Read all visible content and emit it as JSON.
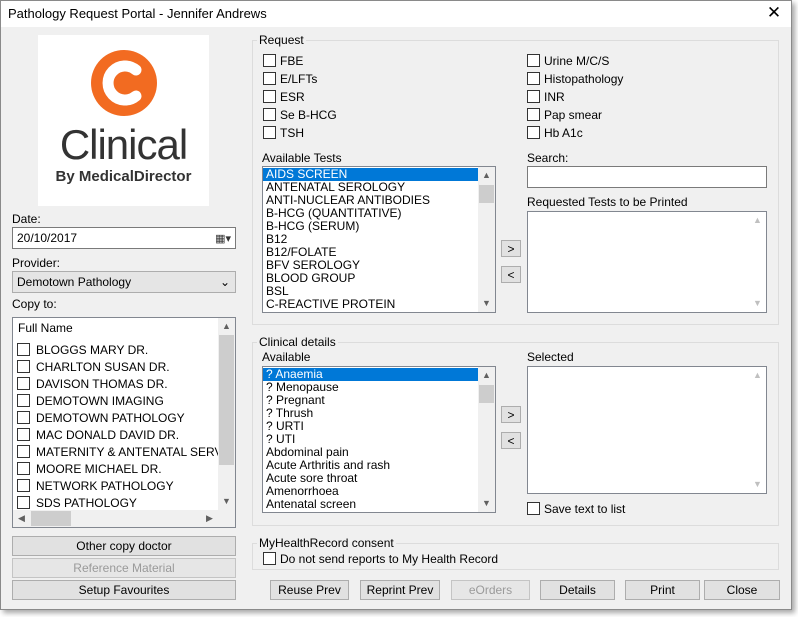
{
  "window": {
    "title": "Pathology Request Portal - Jennifer Andrews"
  },
  "logo": {
    "brand": "Clinical",
    "tagline": "By MedicalDirector",
    "accent": "#f26b21"
  },
  "date": {
    "label": "Date:",
    "value": "20/10/2017"
  },
  "provider": {
    "label": "Provider:",
    "value": "Demotown Pathology"
  },
  "copy_to": {
    "label": "Copy to:",
    "header": "Full Name",
    "items": [
      "BLOGGS MARY DR.",
      "CHARLTON SUSAN DR.",
      "DAVISON THOMAS DR.",
      "DEMOTOWN IMAGING",
      "DEMOTOWN PATHOLOGY",
      "MAC DONALD DAVID DR.",
      "MATERNITY & ANTENATAL SERVICES",
      "MOORE MICHAEL DR.",
      "NETWORK PATHOLOGY",
      "SDS PATHOLOGY"
    ]
  },
  "left_buttons": {
    "other_copy": "Other copy doctor",
    "reference": "Reference Material",
    "favourites": "Setup Favourites"
  },
  "request": {
    "title": "Request",
    "checks_left": [
      "FBE",
      "E/LFTs",
      "ESR",
      "Se B-HCG",
      "TSH"
    ],
    "checks_right": [
      "Urine M/C/S",
      "Histopathology",
      "INR",
      "Pap smear",
      "Hb A1c"
    ],
    "available_label": "Available Tests",
    "available": [
      "AIDS SCREEN",
      "ANTENATAL SEROLOGY",
      "ANTI-NUCLEAR ANTIBODIES",
      "B-HCG (QUANTITATIVE)",
      "B-HCG (SERUM)",
      "B12",
      "B12/FOLATE",
      "BFV SEROLOGY",
      "BLOOD GROUP",
      "BSL",
      "C-REACTIVE PROTEIN"
    ],
    "search_label": "Search:",
    "search_value": "",
    "printed_label": "Requested Tests to be Printed",
    "add": ">",
    "remove": "<"
  },
  "clinical": {
    "title": "Clinical details",
    "available_label": "Available",
    "available": [
      "? Anaemia",
      "? Menopause",
      "? Pregnant",
      "? Thrush",
      "? URTI",
      "? UTI",
      "Abdominal pain",
      "Acute Arthritis and rash",
      "Acute sore throat",
      "Amenorrhoea",
      "Antenatal screen"
    ],
    "selected_label": "Selected",
    "save_text": "Save text to list",
    "add": ">",
    "remove": "<"
  },
  "mhr": {
    "title": "MyHealthRecord consent",
    "check": "Do not send reports to My Health Record"
  },
  "bottom_buttons": {
    "reuse": "Reuse Prev",
    "reprint": "Reprint Prev",
    "eorders": "eOrders",
    "details": "Details",
    "print": "Print",
    "close": "Close"
  }
}
